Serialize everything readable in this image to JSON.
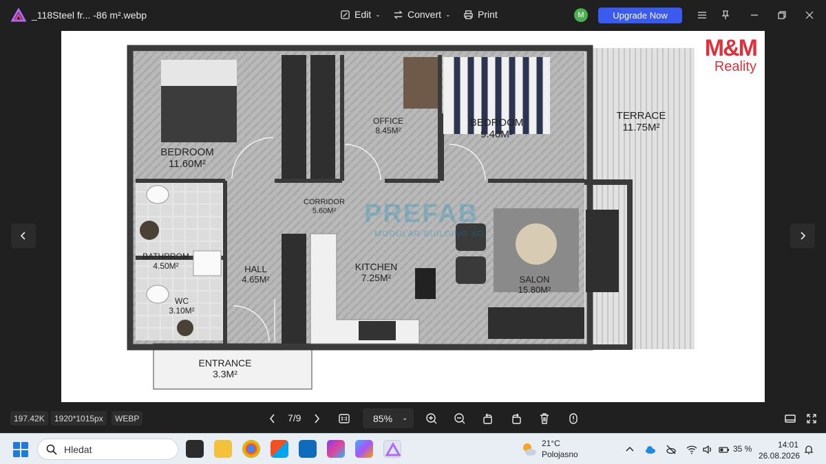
{
  "titlebar": {
    "file_name": "_118Steel fr... -86 m².webp",
    "edit_label": "Edit",
    "convert_label": "Convert",
    "print_label": "Print",
    "avatar_letter": "M",
    "upgrade_label": "Upgrade Now"
  },
  "floorplan": {
    "brand_main": "M&M",
    "brand_sub": "Reality",
    "watermark": "PREFAB",
    "watermark_sub": "MODULAR BUILDING SO",
    "rooms": [
      {
        "name": "BEDROOM",
        "area": "11.60M²"
      },
      {
        "name": "OFFICE",
        "area": "8.45M²"
      },
      {
        "name": "BEDROOM",
        "area": "9.40M²"
      },
      {
        "name": "TERRACE",
        "area": "11.75M²"
      },
      {
        "name": "CORRIDOR",
        "area": "5.60M²"
      },
      {
        "name": "BATHRROM",
        "area": "4.50M²"
      },
      {
        "name": "HALL",
        "area": "4.65M²"
      },
      {
        "name": "KITCHEN",
        "area": "7.25M²"
      },
      {
        "name": "SALON",
        "area": "15.80M²"
      },
      {
        "name": "WC",
        "area": "3.10M²"
      },
      {
        "name": "ENTRANCE",
        "area": "3.3M²"
      }
    ]
  },
  "statusbar": {
    "file_size": "197.42K",
    "dimensions": "1920*1015px",
    "format": "WEBP",
    "page": "7/9",
    "zoom": "85%"
  },
  "taskbar": {
    "search_placeholder": "Hledat",
    "temperature": "21°C",
    "weather": "Polojasno",
    "battery": "35 %",
    "time": "14:01",
    "date": "26.08.2026"
  }
}
